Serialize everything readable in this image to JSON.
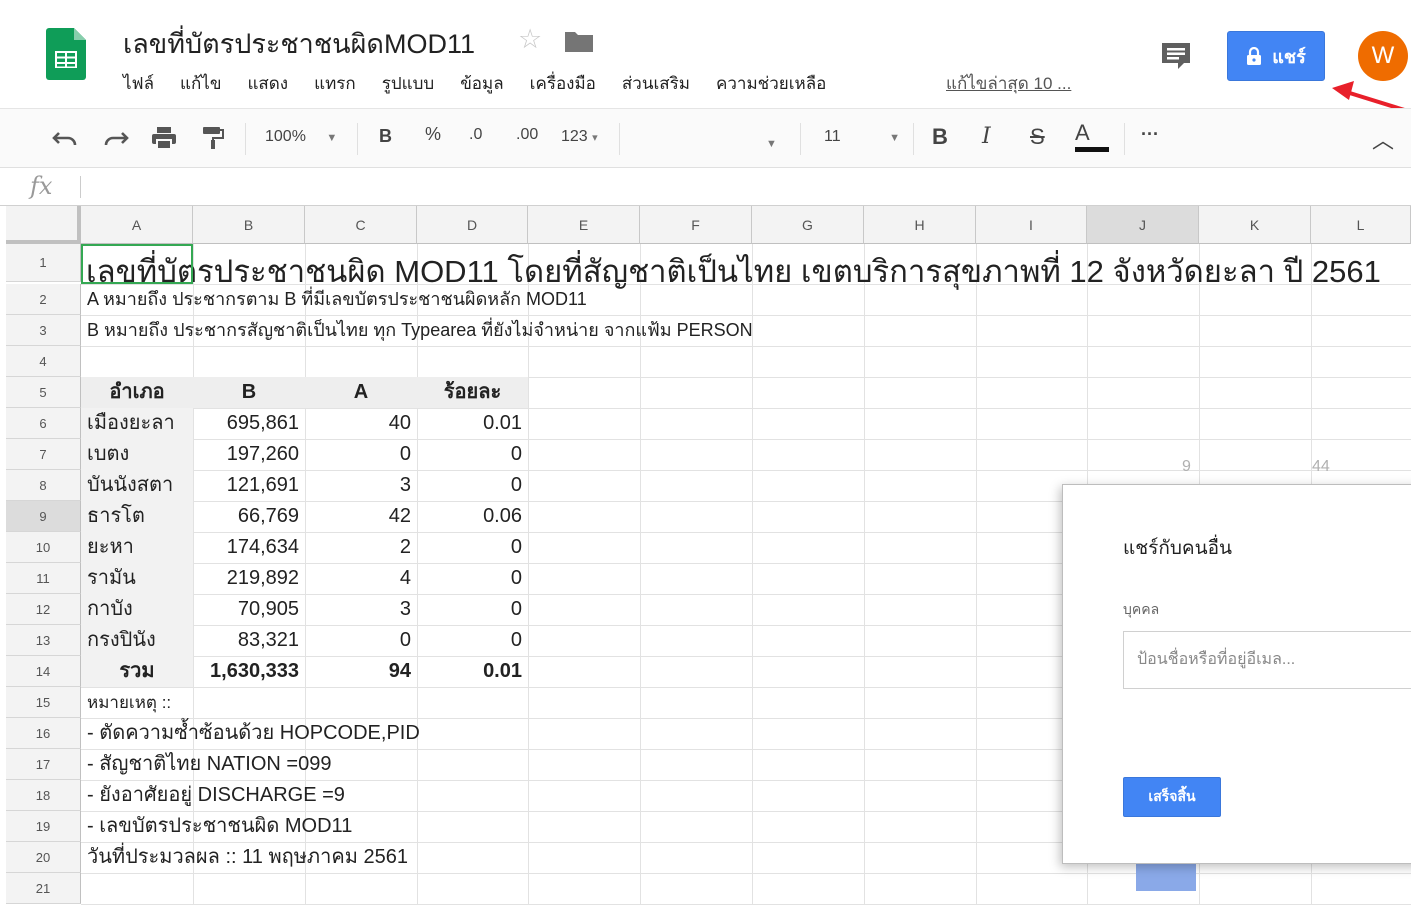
{
  "header": {
    "title": "เลขที่บัตรประชาชนผิดMOD11",
    "menu": [
      "ไฟล์",
      "แก้ไข",
      "แสดง",
      "แทรก",
      "รูปแบบ",
      "ข้อมูล",
      "เครื่องมือ",
      "ส่วนเสริม",
      "ความช่วยเหลือ"
    ],
    "last_edit": "แก้ไขล่าสุด 10 ...",
    "share_label": "แชร์",
    "avatar_initial": "W"
  },
  "toolbar": {
    "zoom": "100%",
    "bold": "B",
    "percent": "%",
    "dec_less": ".0",
    "dec_more": ".00",
    "format_123": "123",
    "font_size": "11",
    "bold2": "B",
    "italic": "I",
    "strike": "S",
    "text_color": "A",
    "more": "···"
  },
  "formula_bar": {
    "fx": "fx"
  },
  "grid": {
    "columns": [
      "A",
      "B",
      "C",
      "D",
      "E",
      "F",
      "G",
      "H",
      "I",
      "J",
      "K",
      "L"
    ],
    "rows": [
      "1",
      "2",
      "3",
      "4",
      "5",
      "6",
      "7",
      "8",
      "9",
      "10",
      "11",
      "12",
      "13",
      "14",
      "15",
      "16",
      "17",
      "18",
      "19",
      "20",
      "21"
    ],
    "title": "เลขที่บัตรประชาชนผิด MOD11 โดยที่สัญชาติเป็นไทย เขตบริการสุขภาพที่ 12 จังหวัดยะลา ปี 2561",
    "note_a": "A หมายถึง ประชากรตาม B ที่มีเลขบัตรประชาชนผิดหลัก MOD11",
    "note_b": "B หมายถึง ประชากรสัญชาติเป็นไทย ทุก Typearea ที่ยังไม่จำหน่าย จากแฟ้ม PERSON",
    "table_headers": [
      "อำเภอ",
      "B",
      "A",
      "ร้อยละ"
    ],
    "table_rows": [
      {
        "name": "เมืองยะลา",
        "b": "695,861",
        "a": "40",
        "pct": "0.01"
      },
      {
        "name": "เบตง",
        "b": "197,260",
        "a": "0",
        "pct": "0"
      },
      {
        "name": "บันนังสตา",
        "b": "121,691",
        "a": "3",
        "pct": "0"
      },
      {
        "name": "ธารโต",
        "b": "66,769",
        "a": "42",
        "pct": "0.06"
      },
      {
        "name": "ยะหา",
        "b": "174,634",
        "a": "2",
        "pct": "0"
      },
      {
        "name": "รามัน",
        "b": "219,892",
        "a": "4",
        "pct": "0"
      },
      {
        "name": "กาบัง",
        "b": "70,905",
        "a": "3",
        "pct": "0"
      },
      {
        "name": "กรงปินัง",
        "b": "83,321",
        "a": "0",
        "pct": "0"
      }
    ],
    "total": {
      "name": "รวม",
      "b": "1,630,333",
      "a": "94",
      "pct": "0.01"
    },
    "remarks": [
      "หมายเหตุ ::",
      "- ตัดความซ้ำซ้อนด้วย HOPCODE,PID",
      "- สัญชาติไทย NATION =099",
      "- ยังอาศัยอยู่ DISCHARGE =9",
      "- เลขบัตรประชาชนผิด MOD11",
      "วันที่ประมวลผล :: 11 พฤษภาคม 2561"
    ],
    "ghost_values": [
      "9",
      "44"
    ]
  },
  "share_dialog": {
    "title": "แชร์กับคนอื่น",
    "people_label": "บุคคล",
    "input_placeholder": "ป้อนชื่อหรือที่อยู่อีเมล...",
    "done_label": "เสร็จสิ้น"
  },
  "colors": {
    "share_blue": "#4285f4",
    "avatar_orange": "#ef6c00",
    "selection_green": "#34a853",
    "annotation_red": "#e8202a"
  }
}
